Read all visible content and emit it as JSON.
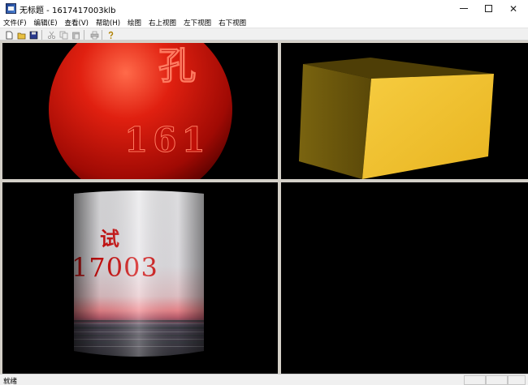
{
  "window": {
    "title": "无标题 - 1617417003klb",
    "minimize": "—",
    "maximize": "☐",
    "close": "✕"
  },
  "menu": {
    "items": [
      "文件(F)",
      "编辑(E)",
      "查看(V)",
      "帮助(H)",
      "绘图",
      "右上视图",
      "左下视图",
      "右下视图"
    ]
  },
  "toolbar": {
    "icons": [
      "new-file-icon",
      "open-folder-icon",
      "save-icon",
      "cut-icon",
      "copy-icon",
      "paste-icon",
      "print-icon",
      "help-icon"
    ]
  },
  "viewports": {
    "top_left": {
      "ball_text_top": "孔",
      "ball_text_bottom": "161"
    },
    "bottom_left": {
      "cyl_text_top": "试",
      "cyl_text_bottom": "17003"
    }
  },
  "statusbar": {
    "text": "就绪"
  },
  "colors": {
    "viewport_bg": "#000000",
    "ball": "#cc1a0a",
    "box_light": "#f0c030",
    "box_dark": "#5a4a0a",
    "frame_bg": "#d4d0c8"
  }
}
